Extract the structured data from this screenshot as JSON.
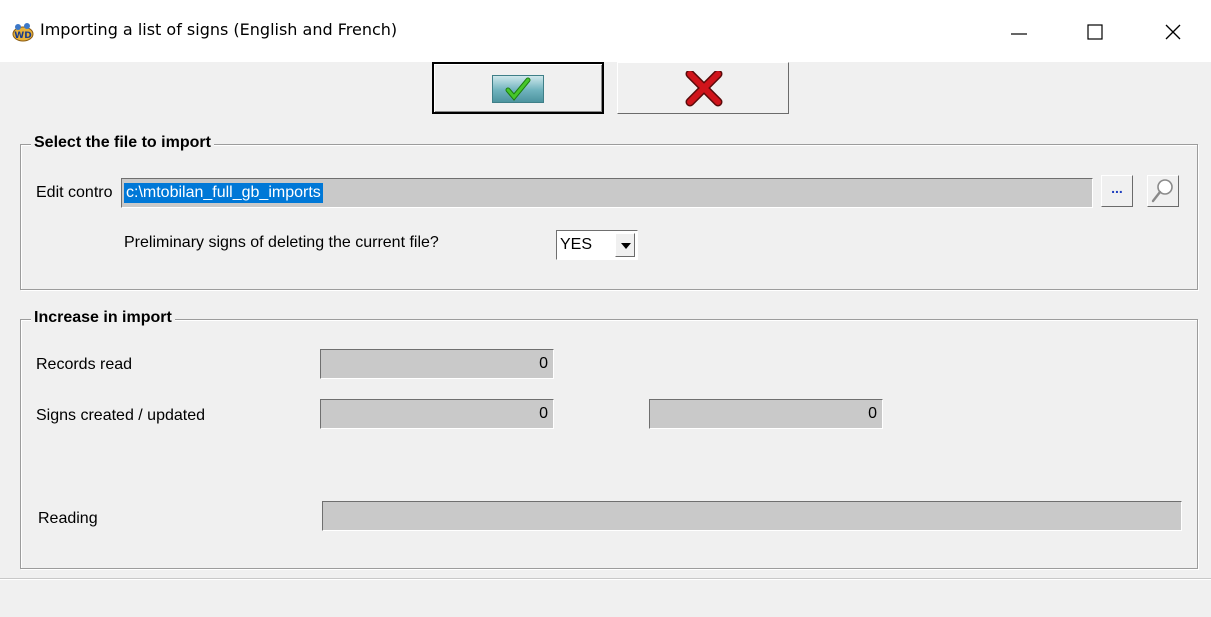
{
  "window": {
    "title": "Importing a list of signs (English and French)",
    "icons": {
      "app": "wd-app-icon",
      "minimize": "minimize-icon",
      "maximize": "maximize-icon",
      "close": "close-icon"
    }
  },
  "toolbar": {
    "ok": {
      "icon": "green-checkmark-icon",
      "accent": "#2e9e1a"
    },
    "cancel": {
      "icon": "red-x-icon",
      "accent": "#d0141b"
    }
  },
  "select_file": {
    "legend": "Select the file to import",
    "edit_label": "Edit contro",
    "file_path": "c:\\mtobilan_full_gb_imports",
    "browse_label": "...",
    "search_icon": "magnifier-icon",
    "delete_question": "Preliminary signs of deleting the current file?",
    "delete_value": "YES"
  },
  "increase": {
    "legend": "Increase in import",
    "records_read_label": "Records read",
    "records_read_value": "0",
    "signs_label": "Signs created / updated",
    "signs_created_value": "0",
    "signs_updated_value": "0",
    "reading_label": "Reading",
    "reading_progress": 0
  },
  "colors": {
    "selection": "#0078d7",
    "face": "#f0f0f0",
    "disabled_field": "#c9c9c9"
  }
}
